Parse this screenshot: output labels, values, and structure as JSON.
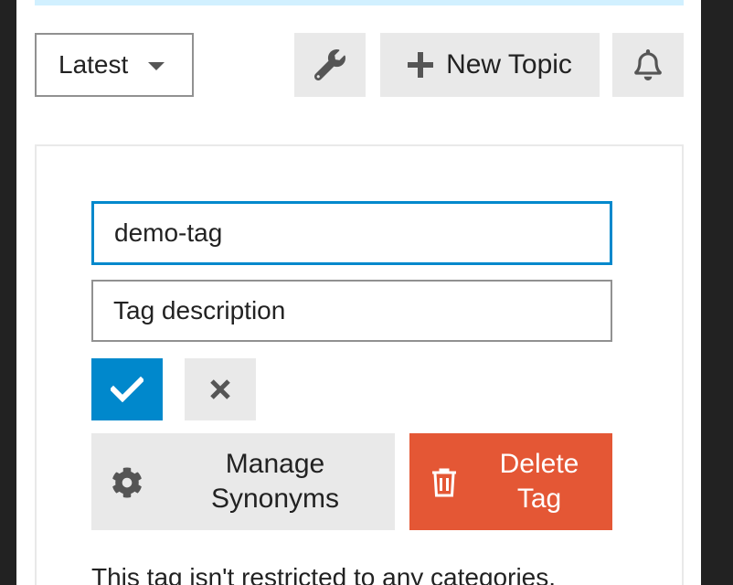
{
  "nav": {
    "filter_label": "Latest",
    "new_topic_label": "New Topic"
  },
  "tag_editor": {
    "name_value": "demo-tag",
    "description_placeholder": "Tag description",
    "manage_synonyms_label": "Manage Synonyms",
    "delete_tag_label": "Delete Tag",
    "restriction_text": "This tag isn't restricted to any categories."
  },
  "icons": {
    "filter_caret": "caret-down-icon",
    "admin": "wrench-icon",
    "new_topic": "plus-icon",
    "notifications": "bell-icon",
    "confirm": "check-icon",
    "cancel": "times-icon",
    "synonyms": "gear-icon",
    "delete": "trash-icon"
  },
  "colors": {
    "primary": "#0088cc",
    "danger": "#e45735",
    "button_grey": "#e9e9e9",
    "banner": "#d1f0ff"
  }
}
